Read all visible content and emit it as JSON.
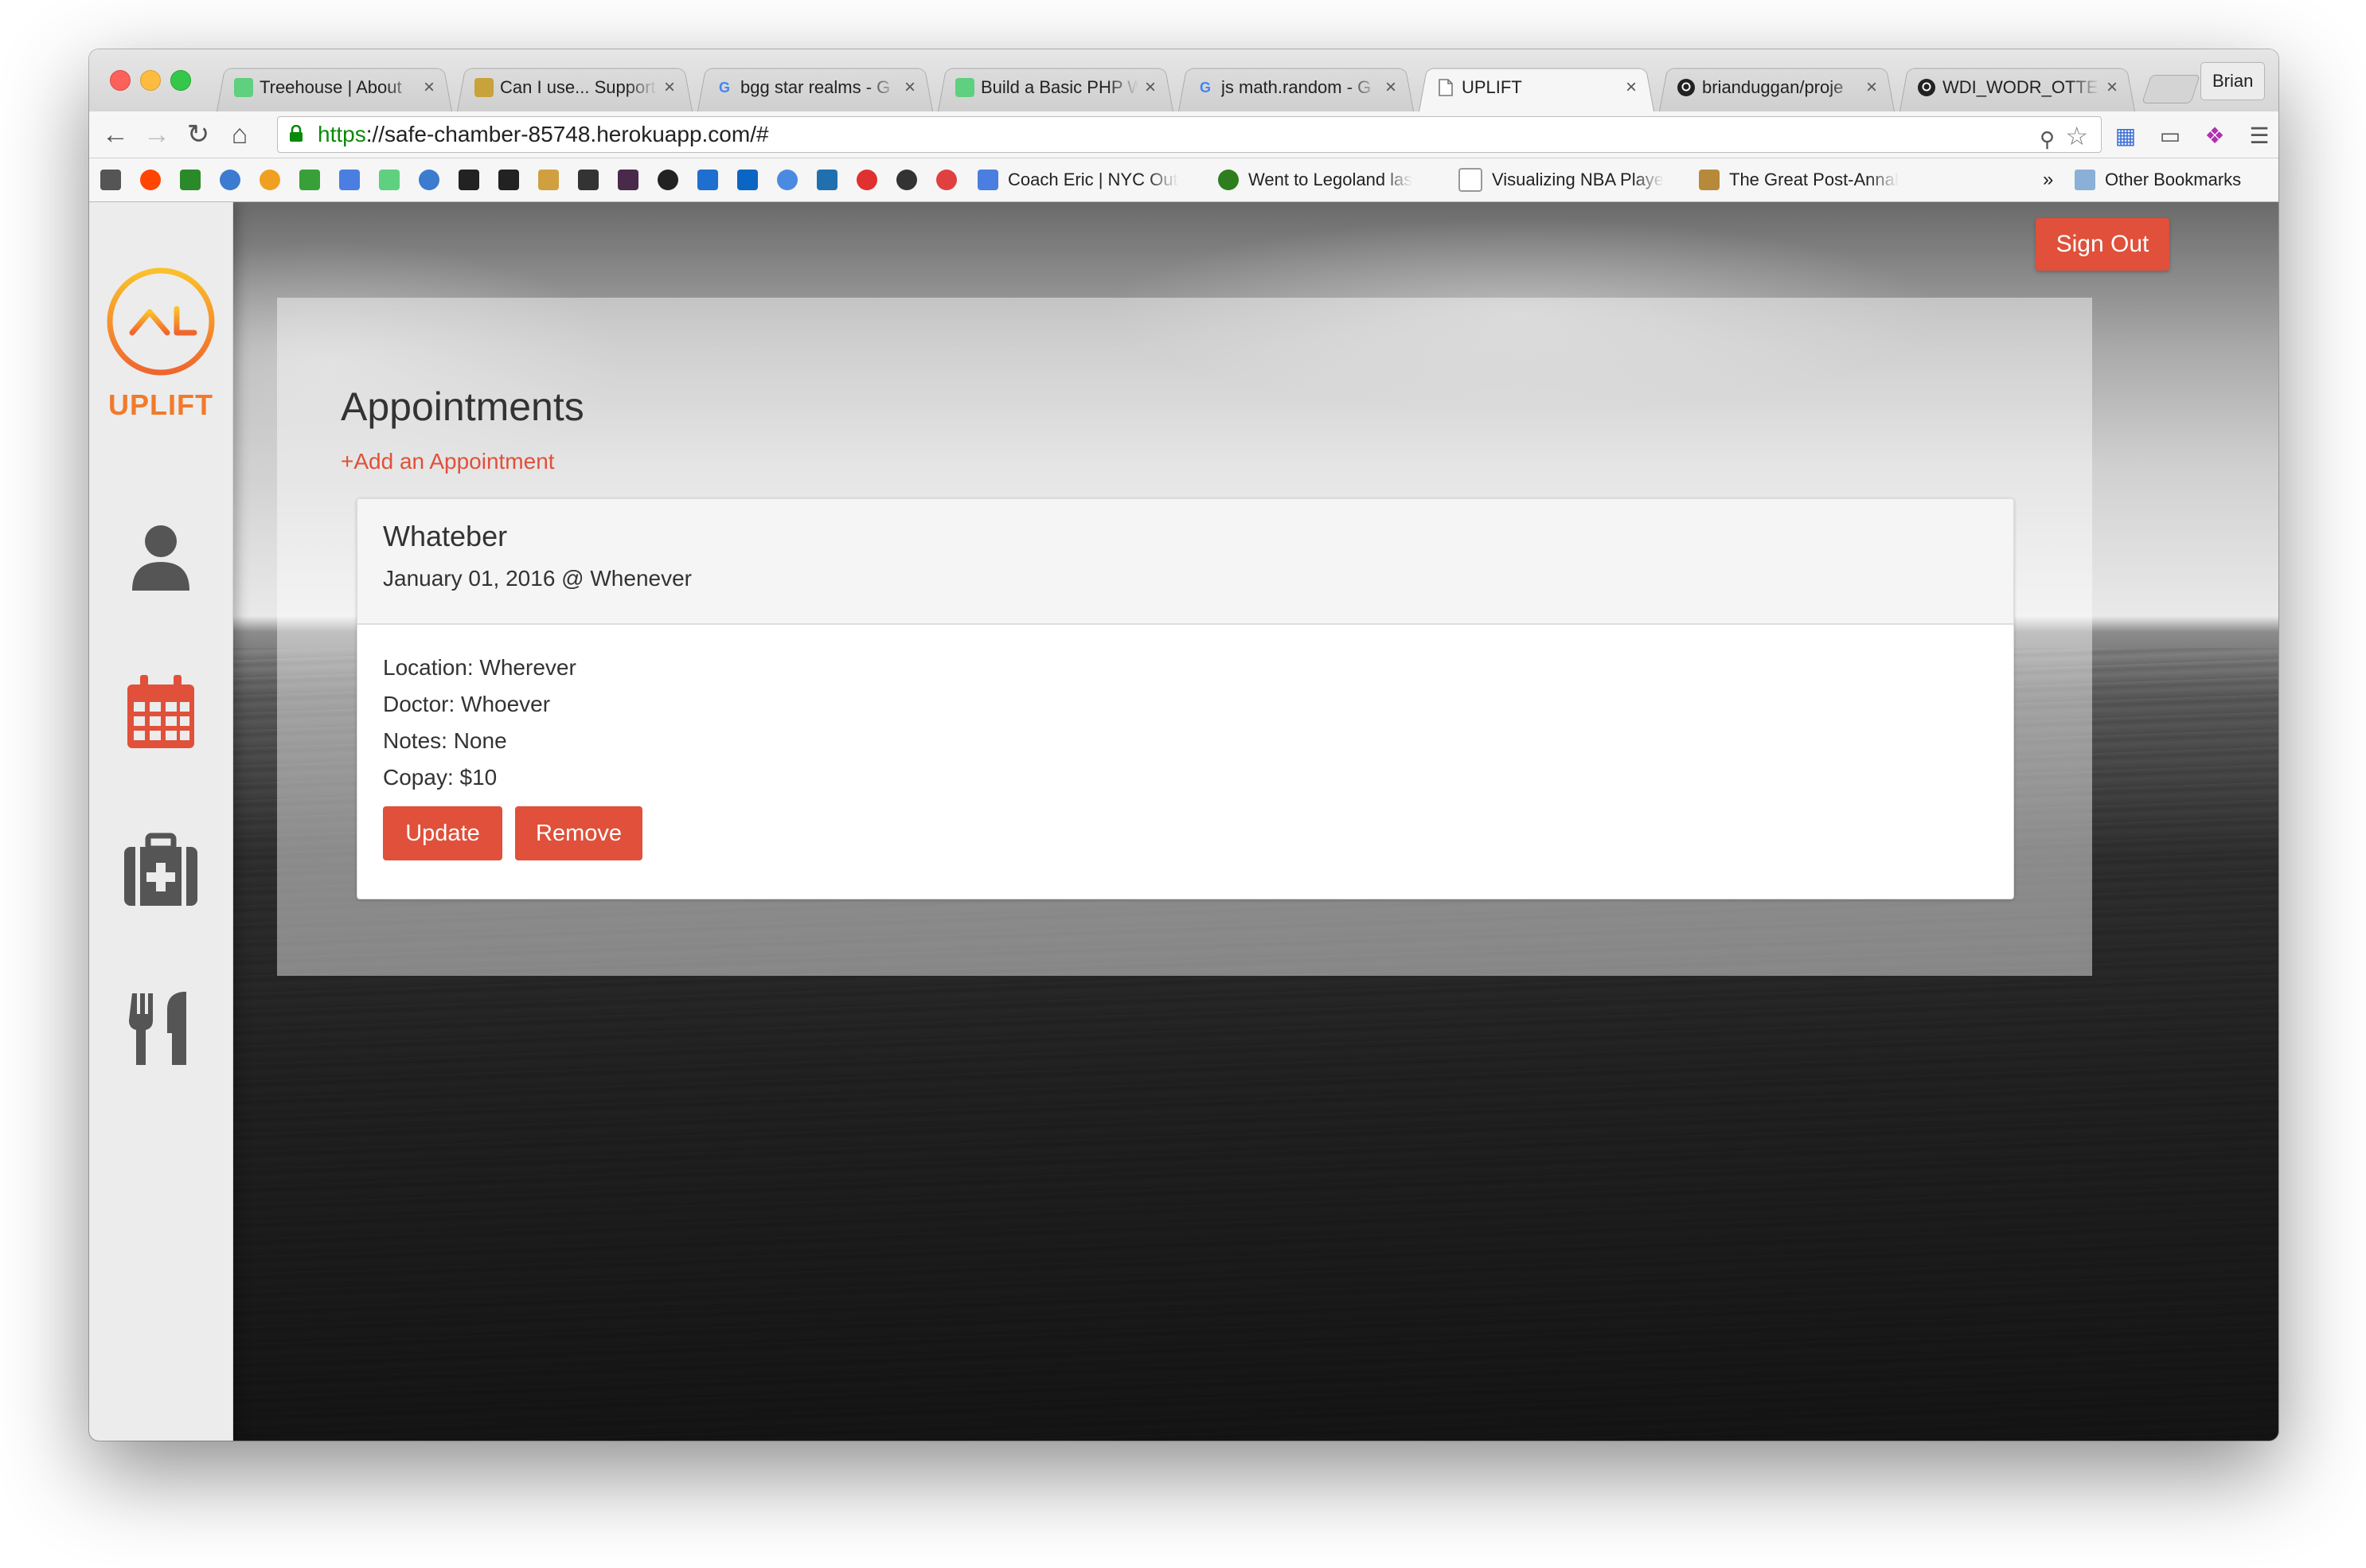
{
  "browser": {
    "tabs": [
      {
        "title": "Treehouse | About",
        "favicon_color": "#5fcf80"
      },
      {
        "title": "Can I use... Support",
        "favicon_color": "#c8a23a"
      },
      {
        "title": "bgg star realms - G",
        "favicon_color": "#4285f4"
      },
      {
        "title": "Build a Basic PHP W",
        "favicon_color": "#5fcf80"
      },
      {
        "title": "js math.random - G",
        "favicon_color": "#4285f4"
      },
      {
        "title": "UPLIFT",
        "favicon_color": "#888888"
      },
      {
        "title": "brianduggan/proje",
        "favicon_color": "#222222"
      },
      {
        "title": "WDI_WODR_OTTER",
        "favicon_color": "#222222"
      }
    ],
    "tab_close_glyph": "×",
    "profile_name": "Brian",
    "url_scheme": "https",
    "url_rest": "://safe-chamber-85748.herokuapp.com/#",
    "bookmarks": [
      {
        "title": "Coach Eric | NYC Out",
        "icon_color": "#4a7ee0"
      },
      {
        "title": "Went to Legoland las",
        "icon_color": "#2e7d1e"
      },
      {
        "title": "Visualizing NBA Playe",
        "icon_color": "#999999"
      },
      {
        "title": "The Great Post-Annal",
        "icon_color": "#b7893a"
      }
    ],
    "bookmarks_overflow": "»",
    "other_bookmarks": "Other Bookmarks"
  },
  "app": {
    "brand": "UPLIFT",
    "brand_color": "#f17a2b",
    "accent_color": "#e0503a",
    "sidebar_icons": [
      "user-icon",
      "calendar-icon",
      "first-aid-kit-icon",
      "utensils-icon"
    ],
    "sign_out_label": "Sign Out",
    "page_title": "Appointments",
    "add_link": "+Add an Appointment",
    "appointment": {
      "title": "Whateber",
      "date_line": "January 01, 2016 @ Whenever",
      "location": "Location: Wherever",
      "doctor": "Doctor: Whoever",
      "notes": "Notes: None",
      "copay": "Copay: $10",
      "update_label": "Update",
      "remove_label": "Remove"
    }
  }
}
